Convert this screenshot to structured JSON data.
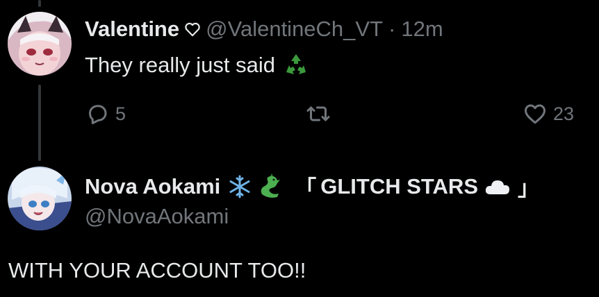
{
  "tweet1": {
    "name": "Valentine",
    "handle": "@ValentineCh_VT",
    "separator": "·",
    "time": "12m",
    "text": "They really just said",
    "replies": "5",
    "retweets": "",
    "likes": "23"
  },
  "tweet2": {
    "name": "Nova Aokami",
    "name_suffix_open": "「",
    "name_tag": "GLITCH STARS",
    "name_suffix_close": "」",
    "handle": "@NovaAokami",
    "text": "WITH YOUR ACCOUNT TOO!!"
  },
  "colors": {
    "background": "#000000",
    "primary_text": "#e7e9ea",
    "secondary_text": "#71767b",
    "thread_line": "#333639",
    "recycle_green": "#3c9a3c"
  },
  "icons": {
    "verified_heart": "heart-outline-icon",
    "recycle": "recycle-emoji-icon",
    "reply": "reply-icon",
    "retweet": "retweet-icon",
    "like": "heart-icon",
    "snowflake": "snowflake-emoji-icon",
    "dragon": "dragon-emoji-icon",
    "cloud": "cloud-emoji-icon"
  }
}
